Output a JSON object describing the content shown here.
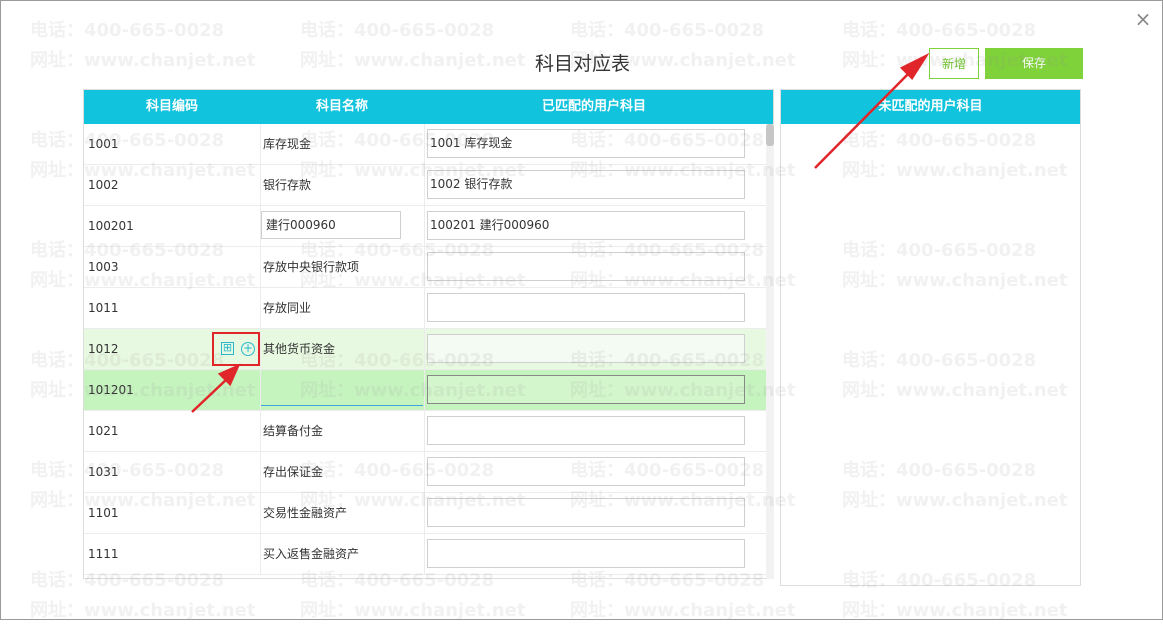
{
  "dialog": {
    "title": "科目对应表",
    "close_glyph": "×",
    "new_button": "新增",
    "save_button": "保存"
  },
  "left_table": {
    "headers": [
      "科目编码",
      "科目名称",
      "已匹配的用户科目"
    ],
    "rows": [
      {
        "code": "1001",
        "name": "库存现金",
        "matched": "1001 库存现金"
      },
      {
        "code": "1002",
        "name": "银行存款",
        "matched": "1002 银行存款"
      },
      {
        "code": "100201",
        "name": "建行000960",
        "matched": "100201 建行000960"
      },
      {
        "code": "1003",
        "name": "存放中央银行款项",
        "matched": ""
      },
      {
        "code": "1011",
        "name": "存放同业",
        "matched": ""
      },
      {
        "code": "1012",
        "name": "其他货币资金",
        "matched": ""
      },
      {
        "code": "101201",
        "name": "",
        "matched": ""
      },
      {
        "code": "1021",
        "name": "结算备付金",
        "matched": ""
      },
      {
        "code": "1031",
        "name": "存出保证金",
        "matched": ""
      },
      {
        "code": "1101",
        "name": "交易性金融资产",
        "matched": ""
      },
      {
        "code": "1111",
        "name": "买入返售金融资产",
        "matched": ""
      }
    ]
  },
  "right_table": {
    "header": "未匹配的用户科目"
  },
  "row_icons": {
    "expand_icon": "⊞",
    "add_icon": "+"
  },
  "watermark": {
    "phone": "电话：400-665-0028",
    "site": "网址：www.chanjet.net"
  },
  "colors": {
    "header_bg": "#12c3dd",
    "accent_green": "#7fd23a",
    "highlight_row": "#c6f4bf",
    "annotation_red": "#e0262a"
  }
}
